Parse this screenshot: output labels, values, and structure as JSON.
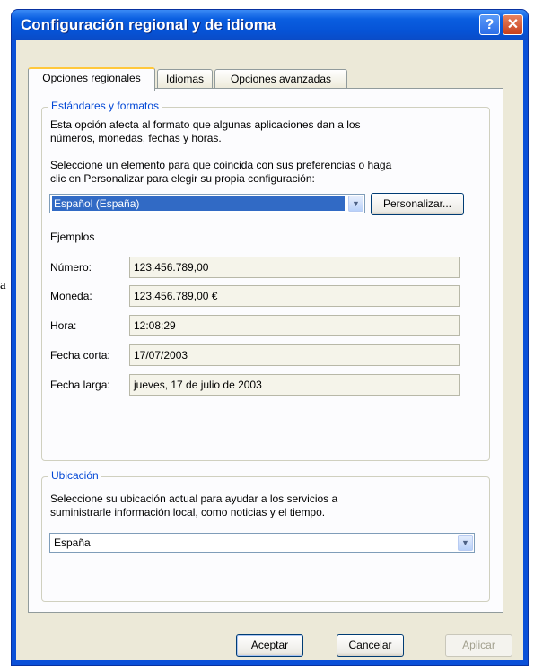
{
  "stray_text": "a",
  "window": {
    "title": "Configuración regional y de idioma",
    "help_label": "?",
    "close_label": "✕"
  },
  "tabs": [
    {
      "label": "Opciones regionales",
      "active": true
    },
    {
      "label": "Idiomas",
      "active": false
    },
    {
      "label": "Opciones avanzadas",
      "active": false
    }
  ],
  "standards": {
    "group_title": "Estándares y formatos",
    "description_line1": "Esta opción afecta al formato que algunas aplicaciones dan a los",
    "description_line2": "números, monedas, fechas y horas.",
    "instruction_line1": "Seleccione un elemento para que coincida con sus preferencias o haga",
    "instruction_line2": "clic en Personalizar para elegir su propia configuración:",
    "selected_locale": "Español (España)",
    "customize_label": "Personalizar...",
    "examples_title": "Ejemplos",
    "examples": [
      {
        "label": "Número:",
        "value": "123.456.789,00"
      },
      {
        "label": "Moneda:",
        "value": "123.456.789,00 €"
      },
      {
        "label": "Hora:",
        "value": "12:08:29"
      },
      {
        "label": "Fecha corta:",
        "value": "17/07/2003"
      },
      {
        "label": "Fecha larga:",
        "value": "jueves, 17 de julio de 2003"
      }
    ]
  },
  "location": {
    "group_title": "Ubicación",
    "description_line1": "Seleccione su ubicación actual para ayudar a los servicios a",
    "description_line2": "suministrarle información local, como noticias y el tiempo.",
    "selected_location": "España"
  },
  "footer": {
    "ok_label": "Aceptar",
    "cancel_label": "Cancelar",
    "apply_label": "Aplicar"
  },
  "icons": {
    "dropdown_arrow": "chevron-down-icon"
  },
  "colors": {
    "titlebar": "#0a5ee0",
    "selection": "#316ac5",
    "group_title": "#0046d5",
    "active_tab_highlight": "#ffc83c"
  }
}
